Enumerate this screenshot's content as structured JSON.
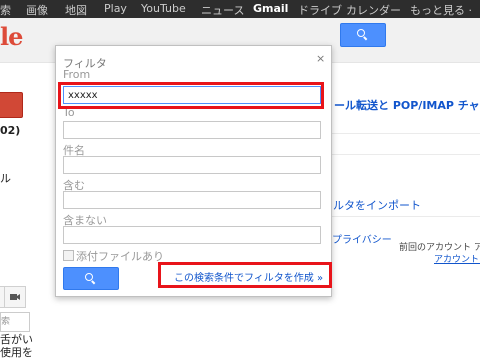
{
  "topnav": [
    "索",
    "画像",
    "地図",
    "Play",
    "YouTube",
    "ニュース",
    "Gmail",
    "ドライブ",
    "カレンダー",
    "もっと見る ·"
  ],
  "logo_fragment": "le",
  "sidebar": {
    "count_fragment": "02)",
    "misc_fragment": "ル",
    "chat_search_placeholder": "索",
    "chat_text_1": "舌がい",
    "chat_text_2": "使用を"
  },
  "settings_tabs_text": "ール転送と POP/IMAP   チャット",
  "import_link": "ィルタをインポート",
  "privacy_link": "とプライバシー",
  "activity_line_1": "前回のアカウント ア",
  "activity_line_2": "アカウント ア",
  "filter_dialog": {
    "title": "フィルタ",
    "close": "×",
    "fields": {
      "from": {
        "label": "From",
        "value": "xxxxx"
      },
      "to": {
        "label": "To",
        "value": ""
      },
      "subject": {
        "label": "件名",
        "value": ""
      },
      "has_words": {
        "label": "含む",
        "value": ""
      },
      "no_words": {
        "label": "含まない",
        "value": ""
      }
    },
    "attachment_label": "添付ファイルあり",
    "attachment_checked": false,
    "create_filter_link": "この検索条件でフィルタを作成 »"
  },
  "colors": {
    "highlight": "#e8141a",
    "accent_blue": "#4d90fe",
    "link_blue": "#1155cc",
    "gmail_red": "#dd4b39",
    "topbar": "#2d2d2d"
  },
  "icons": {
    "search": "magnifier-icon",
    "close": "close-icon",
    "video": "video-icon",
    "person": "person-icon"
  }
}
